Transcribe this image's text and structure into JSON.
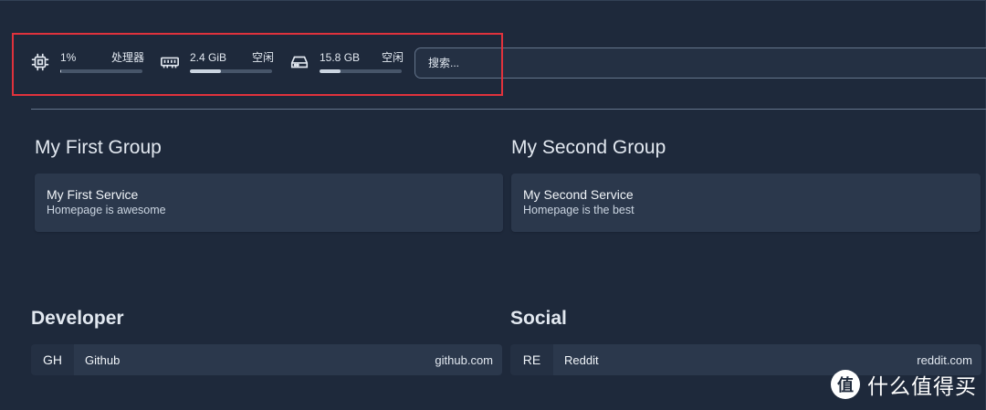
{
  "widgets": {
    "cpu": {
      "icon": "cpu-icon",
      "value": "1%",
      "label": "处理器",
      "usage_percent": 1
    },
    "memory": {
      "icon": "memory-icon",
      "value": "2.4 GiB",
      "label": "空闲",
      "usage_percent": 38
    },
    "disk": {
      "icon": "disk-icon",
      "value": "15.8 GB",
      "label": "空闲",
      "usage_percent": 25
    }
  },
  "search": {
    "placeholder": "搜索..."
  },
  "service_groups": [
    {
      "title": "My First Group",
      "services": [
        {
          "name": "My First Service",
          "description": "Homepage is awesome"
        }
      ]
    },
    {
      "title": "My Second Group",
      "services": [
        {
          "name": "My Second Service",
          "description": "Homepage is the best"
        }
      ]
    }
  ],
  "bookmark_groups": [
    {
      "title": "Developer",
      "bookmarks": [
        {
          "abbr": "GH",
          "name": "Github",
          "url": "github.com"
        }
      ]
    },
    {
      "title": "Social",
      "bookmarks": [
        {
          "abbr": "RE",
          "name": "Reddit",
          "url": "reddit.com"
        }
      ]
    }
  ],
  "watermark": {
    "logo_glyph": "值",
    "text": "什么值得买"
  },
  "colors": {
    "background": "#1e293b",
    "card": "#2b384c",
    "highlight": "#e0323c"
  }
}
